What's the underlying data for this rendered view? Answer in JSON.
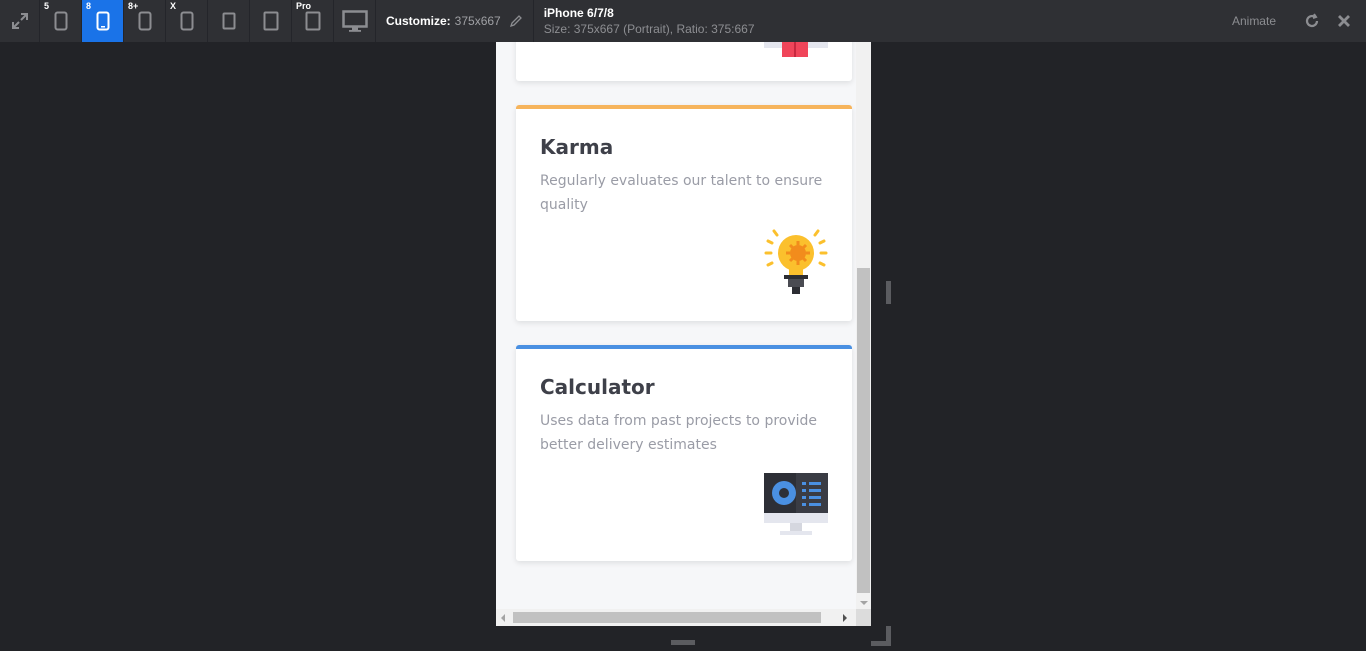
{
  "toolbar": {
    "expand_icon": "expand-arrows-icon",
    "devices": [
      {
        "badge": "5",
        "icon": "phone-icon"
      },
      {
        "badge": "8",
        "icon": "phone-icon",
        "active": true
      },
      {
        "badge": "8+",
        "icon": "phone-icon"
      },
      {
        "badge": "X",
        "icon": "phone-icon"
      },
      {
        "badge": "",
        "icon": "phone-icon"
      },
      {
        "badge": "",
        "icon": "tablet-icon"
      },
      {
        "badge": "Pro",
        "icon": "tablet-icon"
      }
    ],
    "desktop_icon": "monitor-icon",
    "customize_label": "Customize:",
    "customize_value": "375x667",
    "device_name": "iPhone 6/7/8",
    "device_size": "Size: 375x667 (Portrait), Ratio: 375:667",
    "animate_label": "Animate",
    "accent": "#1a73e8"
  },
  "cards": [
    {
      "title": "Karma",
      "description": "Regularly evaluates our talent to ensure quality",
      "accent": "#f6b45c",
      "icon": "lightbulb-icon"
    },
    {
      "title": "Calculator",
      "description": "Uses data from past projects to provide better delivery estimates",
      "accent": "#4a90e2",
      "icon": "computer-icon"
    }
  ]
}
